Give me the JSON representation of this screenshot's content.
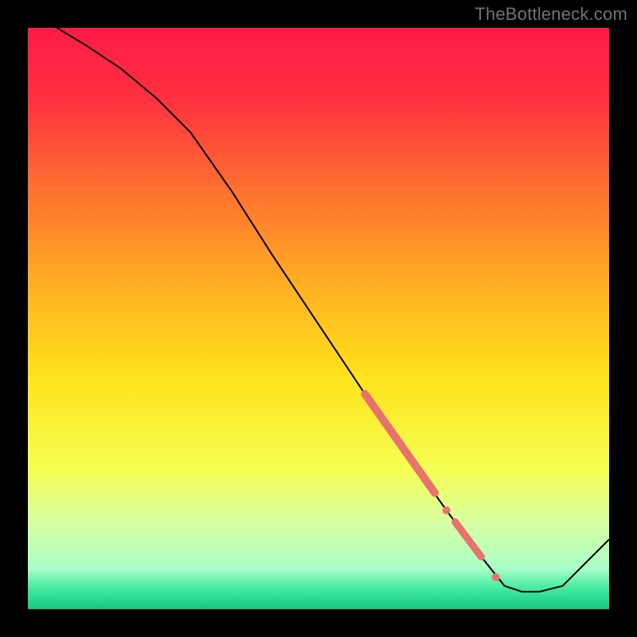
{
  "watermark": "TheBottleneck.com",
  "chart_data": {
    "type": "line",
    "title": "",
    "xlabel": "",
    "ylabel": "",
    "xlim": [
      0,
      100
    ],
    "ylim": [
      0,
      100
    ],
    "background_gradient_stops": [
      {
        "offset": 0.0,
        "color": "#ff1a47"
      },
      {
        "offset": 0.12,
        "color": "#ff3040"
      },
      {
        "offset": 0.28,
        "color": "#ff7030"
      },
      {
        "offset": 0.45,
        "color": "#ffb222"
      },
      {
        "offset": 0.6,
        "color": "#ffe21a"
      },
      {
        "offset": 0.76,
        "color": "#f5ff52"
      },
      {
        "offset": 0.85,
        "color": "#d8ffa0"
      },
      {
        "offset": 0.93,
        "color": "#a8ffc8"
      },
      {
        "offset": 0.965,
        "color": "#43e8a0"
      },
      {
        "offset": 1.0,
        "color": "#12c97e"
      }
    ],
    "series": [
      {
        "name": "bottleneck-curve",
        "color": "#000000",
        "stroke_width": 2,
        "x": [
          5,
          10,
          16,
          22,
          28,
          35,
          42,
          50,
          58,
          65,
          72,
          78,
          82,
          85,
          88,
          92,
          100
        ],
        "y": [
          100,
          97,
          93,
          88,
          82,
          72,
          61,
          49,
          37,
          27,
          17,
          9,
          4,
          3,
          3,
          4,
          12
        ]
      }
    ],
    "highlight_segments": [
      {
        "name": "highlight-upper",
        "color": "#e6736e",
        "width": 10,
        "x1": 58,
        "y1": 37,
        "x2": 70,
        "y2": 20
      },
      {
        "name": "highlight-lower",
        "color": "#e6736e",
        "width": 9,
        "x1": 73.5,
        "y1": 15,
        "x2": 78,
        "y2": 9
      }
    ],
    "highlight_dots": [
      {
        "name": "dot-mid",
        "color": "#e6736e",
        "r": 5,
        "x": 72,
        "y": 17
      },
      {
        "name": "dot-lower",
        "color": "#e6736e",
        "r": 5,
        "x": 80.5,
        "y": 5.5
      }
    ]
  }
}
